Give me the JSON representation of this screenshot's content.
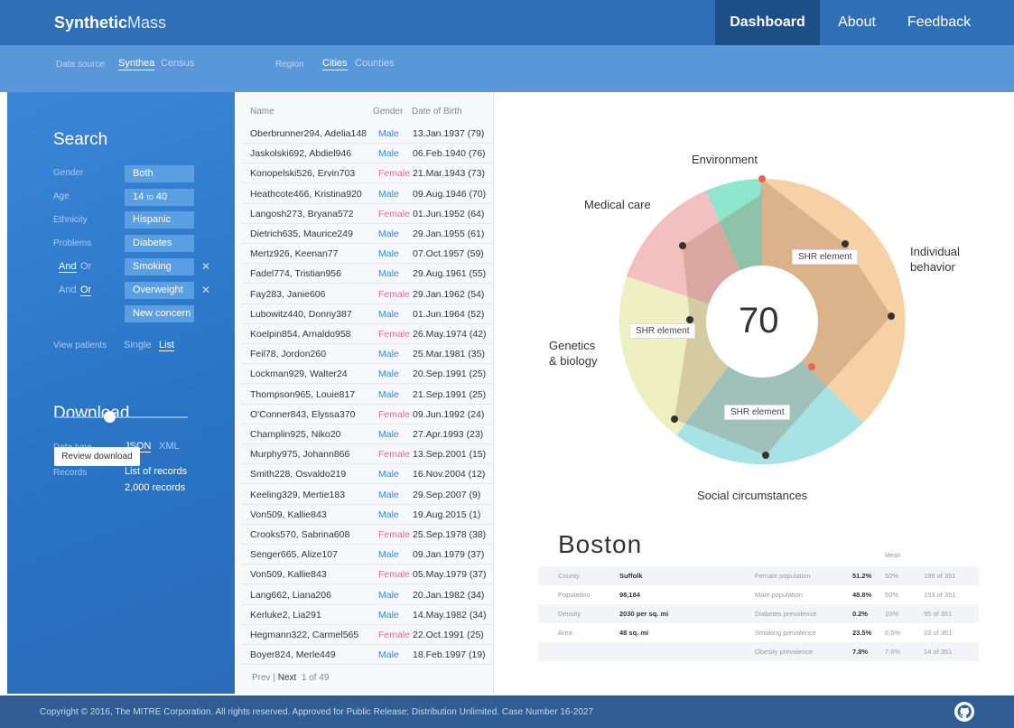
{
  "nav": {
    "brand_bold": "Synthetic",
    "brand_light": "Mass",
    "links": [
      "Dashboard",
      "About",
      "Feedback"
    ],
    "active": "Dashboard"
  },
  "filters": {
    "data_source_label": "Data source",
    "data_source_options": [
      "Synthea",
      "Census"
    ],
    "region_label": "Region",
    "region_options": [
      "Cities",
      "Counties"
    ]
  },
  "search": {
    "title": "Search",
    "gender_label": "Gender",
    "gender_value": "Both",
    "age_label": "Age",
    "age_from": "14",
    "age_to_word": "to",
    "age_to": "40",
    "ethnicity_label": "Ethnicity",
    "ethnicity_value": "Hispanic",
    "problems_label": "Problems",
    "problems": [
      "Diabetes",
      "Smoking",
      "Overweight"
    ],
    "and": "And",
    "or": "Or",
    "new_concern": "New concern",
    "view_patients_label": "View patients",
    "view_single": "Single",
    "view_list": "List"
  },
  "download": {
    "title": "Download",
    "data_type_label": "Data type",
    "data_type_json": "JSON",
    "data_type_xml": "XML",
    "records_label": "Records",
    "records_value": "List of records",
    "records_count": "2,000 records",
    "review_button": "Review download"
  },
  "patients": {
    "headers": [
      "Name",
      "Gender",
      "Date of Birth"
    ],
    "rows": [
      [
        "Oberbrunner294, Adelia148",
        "Male",
        "13.Jan.1937 (79)"
      ],
      [
        "Jaskolski692, Abdiel946",
        "Male",
        "06.Feb.1940 (76)"
      ],
      [
        "Konopelski526, Ervin703",
        "Female",
        "21.Mar.1943 (73)"
      ],
      [
        "Heathcote466, Kristina920",
        "Male",
        "09.Aug.1946 (70)"
      ],
      [
        "Langosh273, Bryana572",
        "Female",
        "01.Jun.1952 (64)"
      ],
      [
        "Dietrich635, Maurice249",
        "Male",
        "29.Jan.1955 (61)"
      ],
      [
        "Mertz926, Keenan77",
        "Male",
        "07.Oct.1957 (59)"
      ],
      [
        "Fadel774, Tristian956",
        "Male",
        "29.Aug.1961 (55)"
      ],
      [
        "Fay283, Janie606",
        "Female",
        "29.Jan.1962 (54)"
      ],
      [
        "Lubowitz440, Donny387",
        "Male",
        "01.Jun.1964 (52)"
      ],
      [
        "Koelpin854, Arnaldo958",
        "Female",
        "26.May.1974 (42)"
      ],
      [
        "Feil78, Jordon260",
        "Male",
        "25.Mar.1981 (35)"
      ],
      [
        "Lockman929, Walter24",
        "Male",
        "20.Sep.1991 (25)"
      ],
      [
        "Thompson965, Louie817",
        "Male",
        "21.Sep.1991 (25)"
      ],
      [
        "O'Conner843, Elyssa370",
        "Female",
        "09.Jun.1992 (24)"
      ],
      [
        "Champlin925, Niko20",
        "Male",
        "27.Apr.1993 (23)"
      ],
      [
        "Murphy975, Johann866",
        "Female",
        "13.Sep.2001 (15)"
      ],
      [
        "Smith228, Osvaldo219",
        "Male",
        "16.Nov.2004 (12)"
      ],
      [
        "Keeling329, Mertie183",
        "Male",
        "29.Sep.2007 (9)"
      ],
      [
        "Von509, Kallie843",
        "Male",
        "19.Aug.2015 (1)"
      ],
      [
        "Crooks570, Sabrina608",
        "Female",
        "25.Sep.1978 (38)"
      ],
      [
        "Senger665, Alize107",
        "Male",
        "09.Jan.1979 (37)"
      ],
      [
        "Von509, Kallie843",
        "Female",
        "05.May.1979 (37)"
      ],
      [
        "Lang662, Liana206",
        "Male",
        "20.Jan.1982 (34)"
      ],
      [
        "Kerluke2, Lia291",
        "Male",
        "14.May.1982 (34)"
      ],
      [
        "Hegmann322, Carmel565",
        "Female",
        "22.Oct.1991 (25)"
      ],
      [
        "Boyer824, Merle449",
        "Male",
        "18.Feb.1997 (19)"
      ]
    ],
    "pager_prev": "Prev",
    "pager_next": "Next",
    "pager_info": "1 of 49"
  },
  "chart": {
    "score": "70",
    "labels": {
      "environment": "Environment",
      "medical_care": "Medical care",
      "individual_behavior_1": "Individual",
      "individual_behavior_2": "behavior",
      "genetics_1": "Genetics",
      "genetics_2": "& biology",
      "social": "Social circumstances"
    },
    "shr_label": "SHR element",
    "colors": {
      "environment": "#8ee6cc",
      "medical": "#f3c0c2",
      "individual": "#f6d1a6",
      "social": "#a7e3e4",
      "genetics": "#eef0c4"
    }
  },
  "chart_data": {
    "type": "radar",
    "score": 70,
    "categories": [
      "Environment",
      "Medical care",
      "Individual behavior",
      "Genetics & biology",
      "Social circumstances"
    ]
  },
  "city": {
    "name": "Boston",
    "mean_label": "Mean",
    "rows": [
      {
        "k1": "County",
        "v1": "Suffolk",
        "k2": "Female population",
        "v2": "51.2%",
        "m": "50%",
        "r": "199 of 351"
      },
      {
        "k1": "Population",
        "v1": "98,184",
        "k2": "Male population",
        "v2": "48.8%",
        "m": "50%",
        "r": "153 of 351"
      },
      {
        "k1": "Density",
        "v1": "2030 per sq. mi",
        "k2": "Diabetes prevalence",
        "v2": "0.2%",
        "m": "10%",
        "r": "95 of 351"
      },
      {
        "k1": "Area",
        "v1": "48 sq. mi",
        "k2": "Smoking prevalence",
        "v2": "23.5%",
        "m": "6.5%",
        "r": "23 of 351"
      },
      {
        "k1": "",
        "v1": "",
        "k2": "Obesity prevalence",
        "v2": "7.8%",
        "m": "7.6%",
        "r": "14 of 351"
      }
    ]
  },
  "footer": {
    "text": "Copyright © 2016, The MITRE Corporation. All rights reserved. Approved for Public Release; Distribution Unlimited. Case Number 16-2027"
  }
}
